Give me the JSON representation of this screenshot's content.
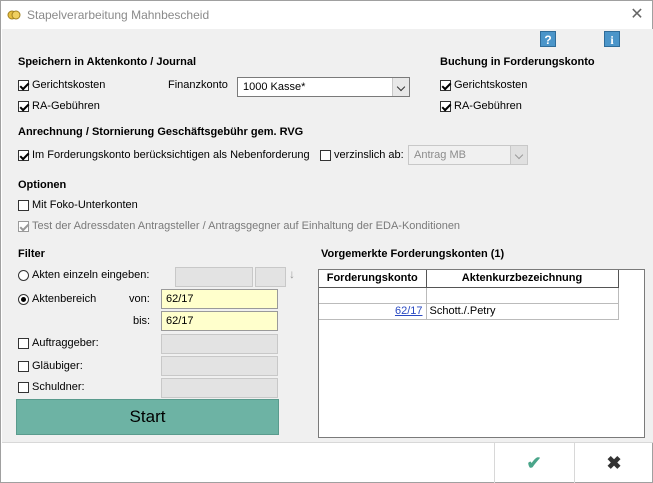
{
  "window": {
    "title": "Stapelverarbeitung Mahnbescheid",
    "close_glyph": "✕"
  },
  "toolbar": {
    "help_glyph": "?",
    "info_glyph": "i"
  },
  "speichern": {
    "heading": "Speichern in Aktenkonto / Journal",
    "gerichtskosten": {
      "label": "Gerichtskosten",
      "checked": true
    },
    "ra_gebuehren": {
      "label": "RA-Gebühren",
      "checked": true
    },
    "finanzkonto_label": "Finanzkonto",
    "finanzkonto_value": "1000 Kasse*"
  },
  "buchung": {
    "heading": "Buchung in Forderungskonto",
    "gerichtskosten": {
      "label": "Gerichtskosten",
      "checked": true
    },
    "ra_gebuehren": {
      "label": "RA-Gebühren",
      "checked": true
    }
  },
  "anrechnung": {
    "heading": "Anrechnung / Stornierung Geschäftsgebühr gem. RVG",
    "nebenforderung": {
      "label": "Im Forderungskonto berücksichtigen als Nebenforderung",
      "checked": true
    },
    "verzinslich": {
      "label": "verzinslich ab:",
      "checked": false
    },
    "verzinslich_value": "Antrag MB"
  },
  "optionen": {
    "heading": "Optionen",
    "foko": {
      "label": "Mit Foko-Unterkonten",
      "checked": false
    },
    "eda": {
      "label": "Test der Adressdaten Antragsteller / Antragsgegner auf Einhaltung der EDA-Konditionen",
      "checked": true
    }
  },
  "filter": {
    "heading": "Filter",
    "einzeln": {
      "label": "Akten einzeln eingeben:"
    },
    "bereich": {
      "label": "Aktenbereich",
      "von_label": "von:",
      "von_value": "62/17",
      "bis_label": "bis:",
      "bis_value": "62/17"
    },
    "auftraggeber": {
      "label": "Auftraggeber:"
    },
    "glaeubiger": {
      "label": "Gläubiger:"
    },
    "schuldner": {
      "label": "Schuldner:"
    },
    "down_arrow": "↓"
  },
  "start_label": "Start",
  "vorgemerkt": {
    "heading": "Vorgemerkte Forderungskonten (1)",
    "columns": [
      "Forderungskonto",
      "Aktenkurzbezeichnung"
    ],
    "rows": [
      {
        "konto": "",
        "bezeichnung": ""
      },
      {
        "konto": "62/17",
        "bezeichnung": "Schott./.Petry"
      }
    ]
  },
  "footer": {
    "ok_glyph": "✔",
    "cancel_glyph": "✖",
    "ok_color": "#4aa58a",
    "cancel_color": "#333333"
  }
}
